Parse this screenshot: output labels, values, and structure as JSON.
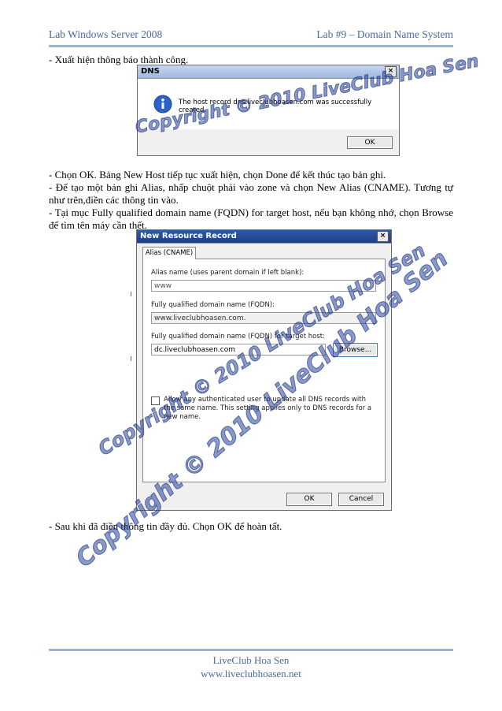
{
  "header": {
    "left": "Lab Windows Server 2008",
    "right": "Lab #9 – Domain Name System"
  },
  "footer": {
    "line1": "LiveClub Hoa Sen",
    "line2": "www.liveclubhoasen.net"
  },
  "paragraphs": {
    "p1": "- Xuất hiện thông báo thành công.",
    "p2": "- Chọn OK. Bảng New Host tiếp tục xuất hiện, chọn Done để kết thúc tạo bản ghi.",
    "p3": "- Để tạo một bản ghi Alias, nhấp chuột phải vào zone và chọn New Alias (CNAME). Tương tự như trên,điền các thông tin vào.",
    "p4": "- Tại mục Fully qualified domain name (FQDN) for target host, nếu bạn không nhớ, chọn Browse để tìm tên máy cần thết.",
    "p5": "- Sau khi đã điền thông tin đầy đủ. Chọn OK để hoàn tất."
  },
  "dns_dialog": {
    "title": "DNS",
    "close": "×",
    "icon": "info-icon",
    "message": "The host record dns.liveclubhoasen.com was successfully created.",
    "ok": "OK"
  },
  "record_dialog": {
    "title": "New Resource Record",
    "close": "×",
    "tab": "Alias (CNAME)",
    "alias_label": "Alias name (uses parent domain if left blank):",
    "alias_value": "www",
    "fqdn_label": "Fully qualified domain name (FQDN):",
    "fqdn_value": "www.liveclubhoasen.com.",
    "target_label": "Fully qualified domain name (FQDN) for target host:",
    "target_value": "dc.liveclubhoasen.com",
    "browse": "Browse...",
    "checkbox_label": "Allow any authenticated user to update all DNS records with the same name. This setting applies only to DNS records for a new name.",
    "ok": "OK",
    "cancel": "Cancel"
  },
  "watermarks": {
    "w1": "Copyright © 2010 LiveClub Hoa Sen",
    "w2": "Copyright © 2010 LiveClub Hoa Sen",
    "w3": "Copyright © 2010 LiveClub Hoa Sen"
  }
}
